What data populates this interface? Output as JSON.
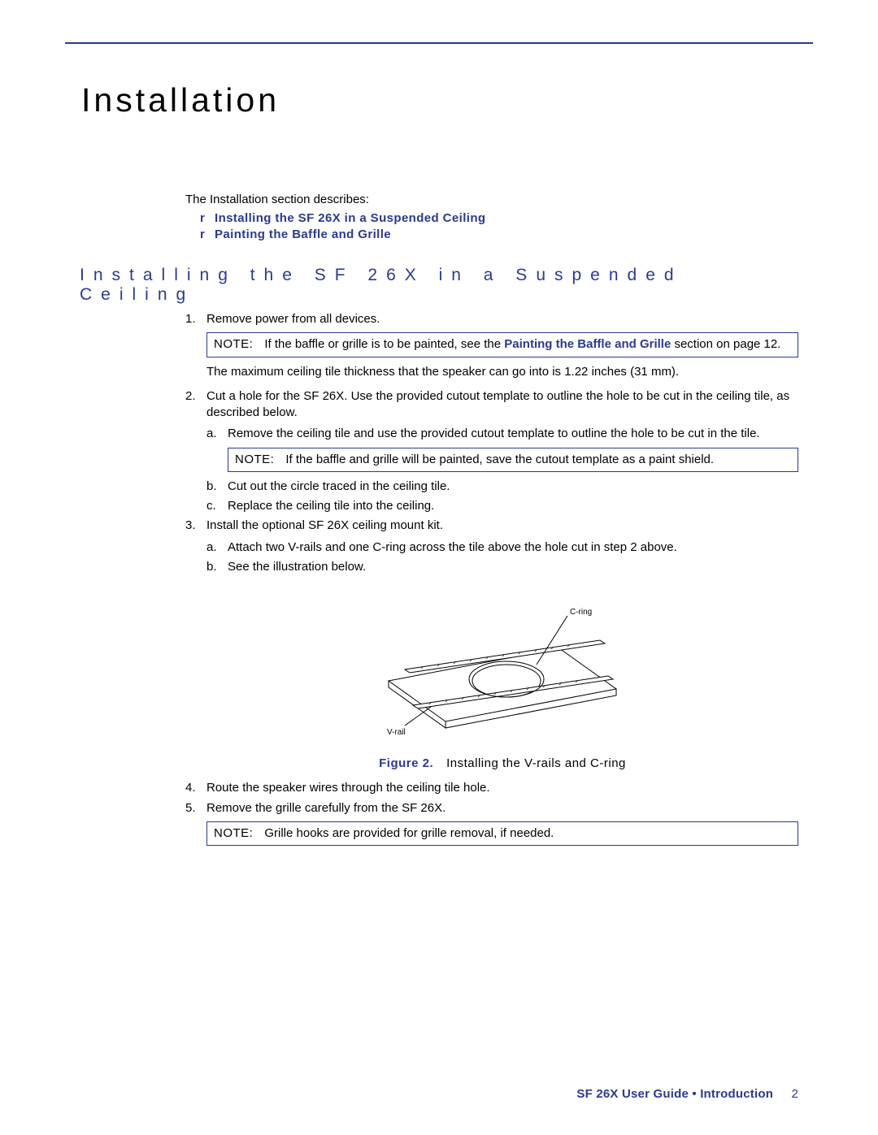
{
  "chapter_title": "Installation",
  "intro_text": "The Installation section describes:",
  "toc": [
    {
      "bullet": "r",
      "label": "Installing the SF 26X in a Suspended Ceiling"
    },
    {
      "bullet": "r",
      "label": "Painting the Baffle and Grille"
    }
  ],
  "section_heading": "Installing the SF 26X in a Suspended Ceiling",
  "steps": {
    "s1_num": "1.",
    "s1_text": "Remove power from all devices.",
    "note1_label": "NOTE:",
    "note1_pre": "If the baffle or grille is to be painted, see the ",
    "note1_link": "Painting the Baffle and Grille",
    "note1_post": " section on page 12.",
    "max_thickness": "The maximum ceiling tile thickness that the speaker can go into is 1.22 inches (31 mm).",
    "s2_num": "2.",
    "s2_text": "Cut a hole for the SF 26X. Use the provided cutout template to outline the hole to be cut in the ceiling tile, as described below.",
    "s2a_letter": "a.",
    "s2a_text": "Remove the ceiling tile and use the provided cutout template to outline the hole to be cut in the tile.",
    "note2_label": "NOTE:",
    "note2_text": "If the baffle and grille will be painted, save the cutout template as a paint shield.",
    "s2b_letter": "b.",
    "s2b_text": "Cut out the circle traced in the ceiling tile.",
    "s2c_letter": "c.",
    "s2c_text": "Replace the ceiling tile into the ceiling.",
    "s3_num": "3.",
    "s3_text": "Install the optional SF 26X ceiling mount kit.",
    "s3a_letter": "a.",
    "s3a_text": "Attach two V-rails and one C-ring across the tile above the hole cut in step 2 above.",
    "s3b_letter": "b.",
    "s3b_text": "See the illustration below.",
    "s4_num": "4.",
    "s4_text": "Route the speaker wires through the ceiling tile hole.",
    "s5_num": "5.",
    "s5_text": "Remove the grille carefully from the SF 26X.",
    "note3_label": "NOTE:",
    "note3_text": "Grille hooks are provided for grille removal, if needed."
  },
  "figure": {
    "label_cring": "C-ring",
    "label_vrail": "V-rail",
    "caption_label": "Figure 2.",
    "caption_text": "Installing the V-rails and C-ring"
  },
  "footer": {
    "text": "SF 26X User Guide • Introduction",
    "page_number": "2"
  }
}
